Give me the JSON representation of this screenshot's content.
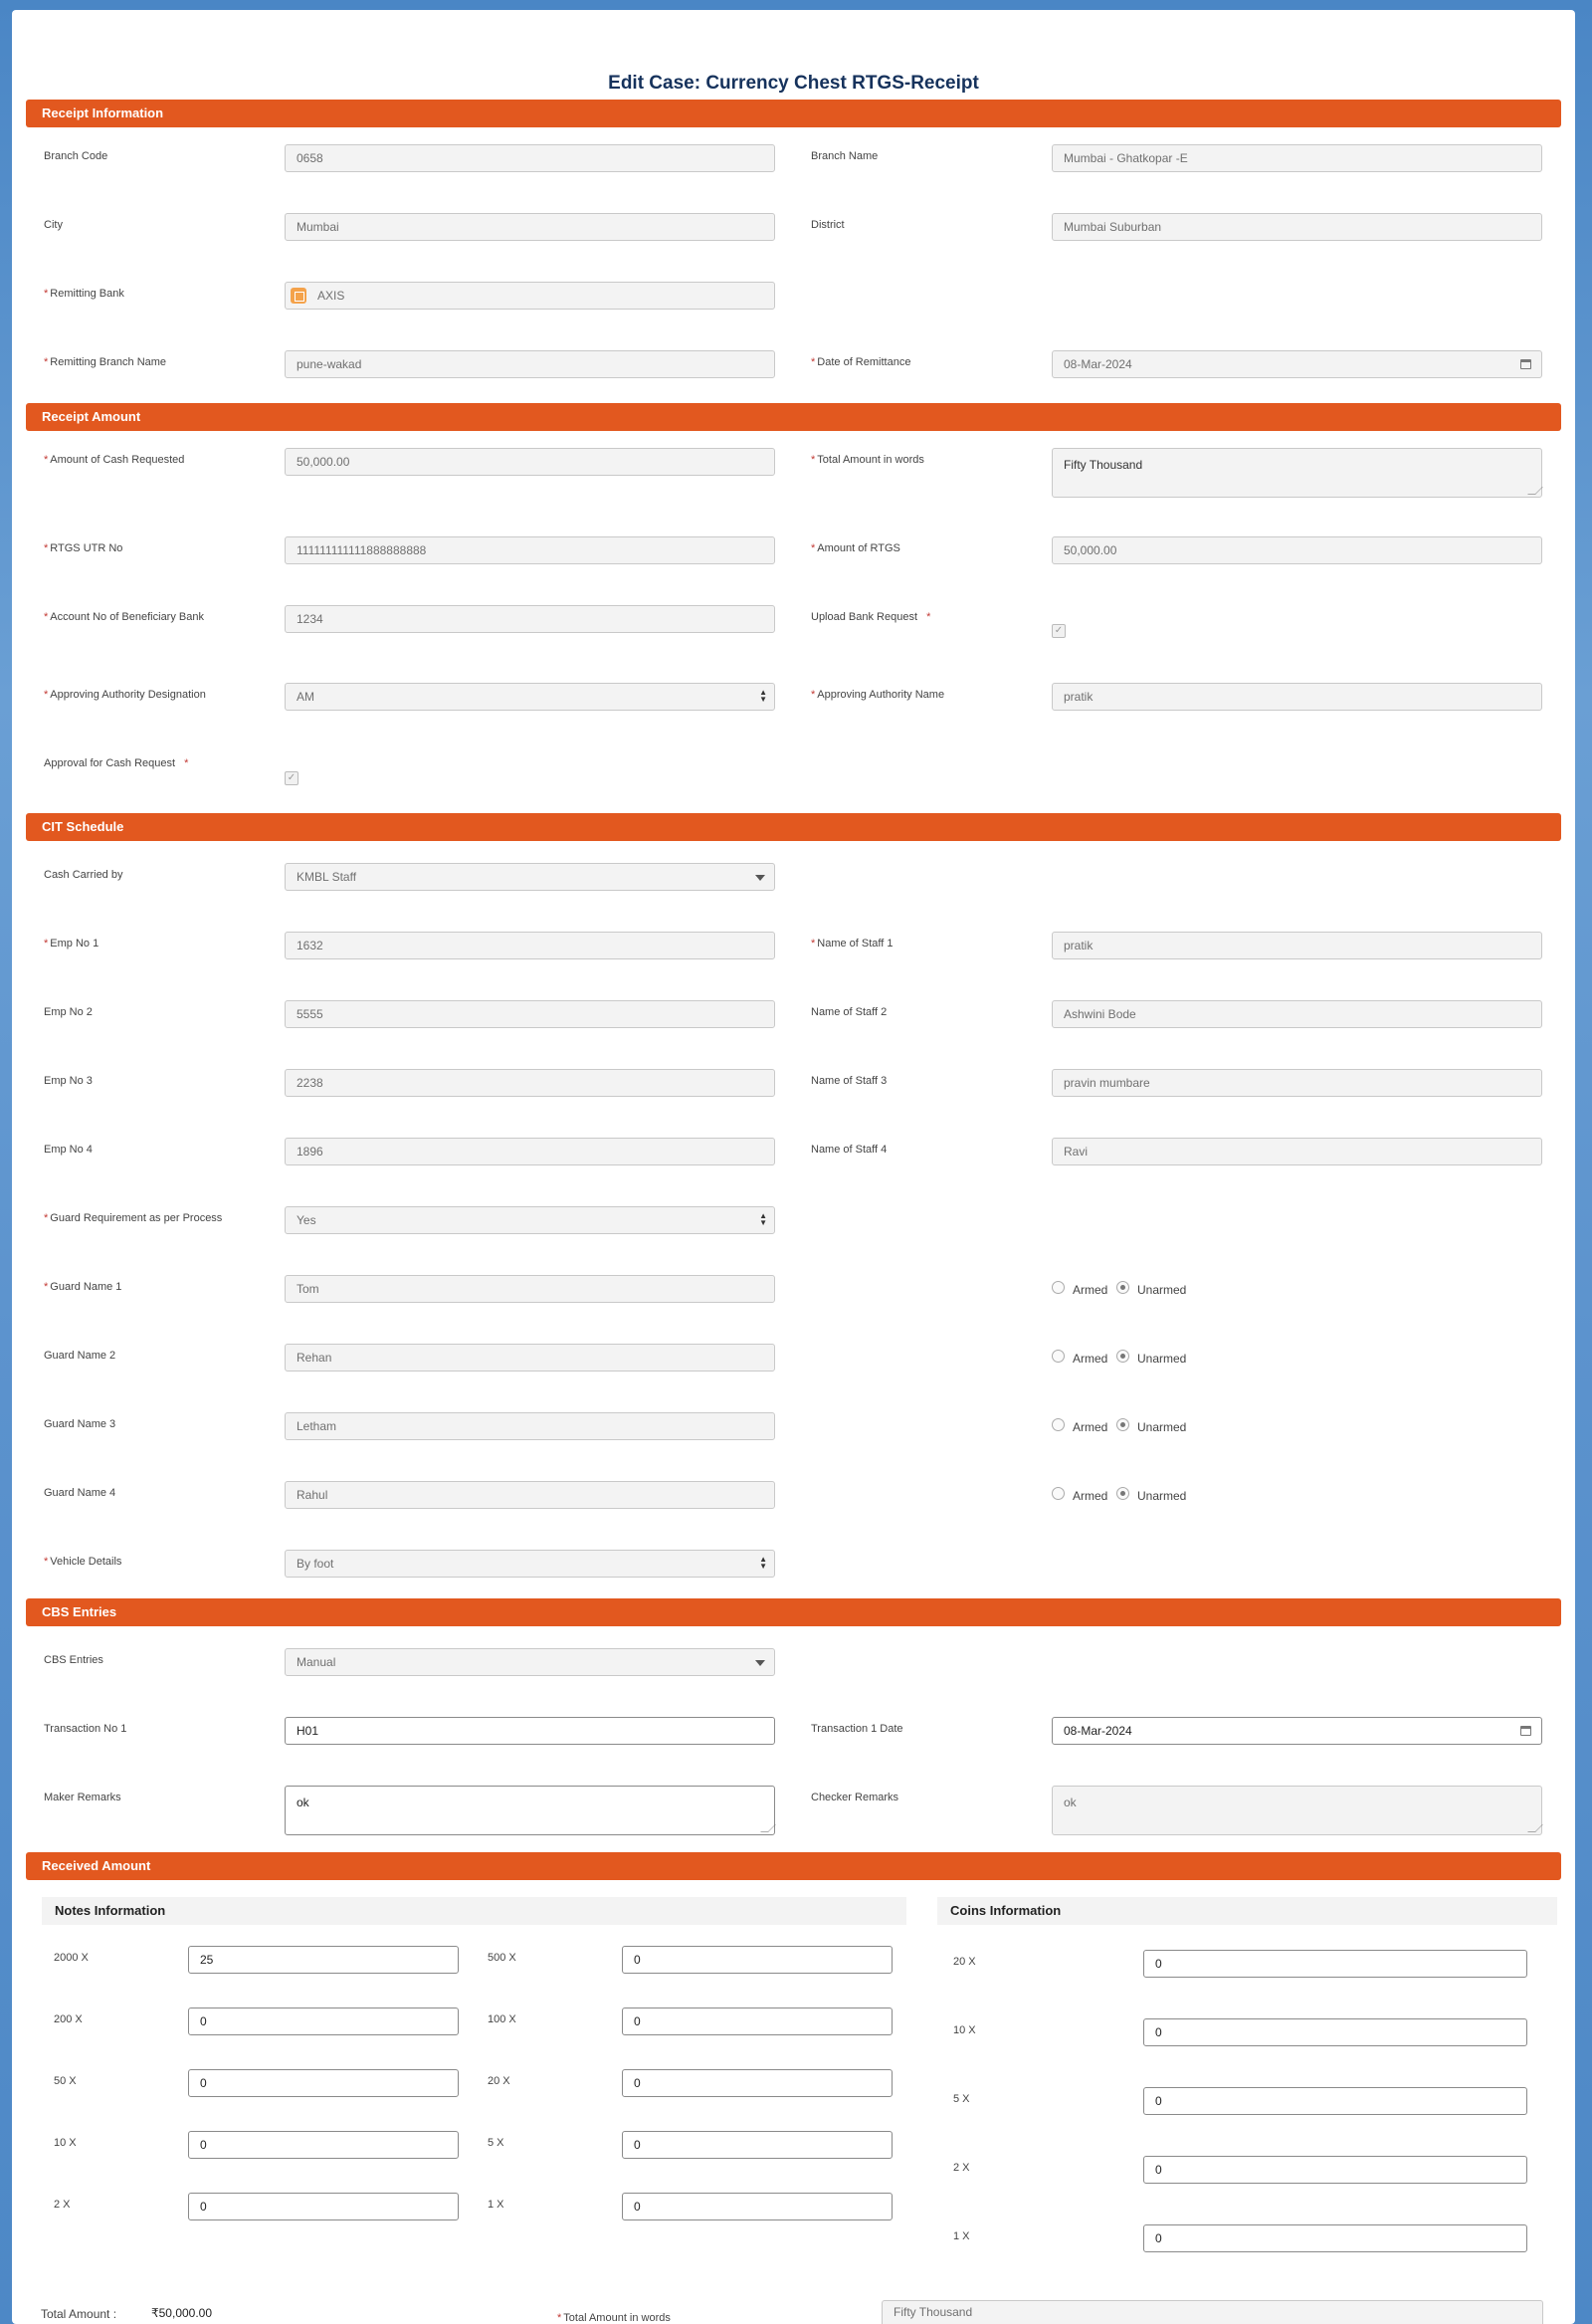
{
  "title": "Edit Case: Currency Chest RTGS-Receipt",
  "sections": {
    "receipt_info": "Receipt Information",
    "receipt_amount": "Receipt Amount",
    "cit_schedule": "CIT Schedule",
    "cbs_entries": "CBS Entries",
    "received_amount": "Received Amount"
  },
  "receipt_info": {
    "branch_code_label": "Branch Code",
    "branch_code": "0658",
    "branch_name_label": "Branch Name",
    "branch_name": "Mumbai - Ghatkopar -E",
    "city_label": "City",
    "city": "Mumbai",
    "district_label": "District",
    "district": "Mumbai Suburban",
    "remitting_bank_label": "Remitting Bank",
    "remitting_bank": "AXIS",
    "remitting_branch_label": "Remitting Branch Name",
    "remitting_branch": "pune-wakad",
    "date_label": "Date of Remittance",
    "date": "08-Mar-2024"
  },
  "receipt_amount": {
    "cash_requested_label": "Amount of Cash Requested",
    "cash_requested": "50,000.00",
    "words_label": "Total Amount in words",
    "words": "Fifty  Thousand",
    "utr_label": "RTGS UTR No",
    "utr": "111111111111888888888",
    "rtgs_amount_label": "Amount of RTGS",
    "rtgs_amount": "50,000.00",
    "account_label": "Account No of Beneficiary Bank",
    "account": "1234",
    "upload_label": "Upload Bank Request",
    "designation_label": "Approving Authority Designation",
    "designation": "AM",
    "authority_name_label": "Approving Authority Name",
    "authority_name": "pratik",
    "approval_label": "Approval for Cash Request"
  },
  "cit": {
    "carried_label": "Cash Carried by",
    "carried": "KMBL Staff",
    "emp1_label": "Emp No 1",
    "emp1": "1632",
    "staff1_label": "Name of Staff 1",
    "staff1": "pratik",
    "emp2_label": "Emp No 2",
    "emp2": "5555",
    "staff2_label": "Name of Staff 2",
    "staff2": "Ashwini Bode",
    "emp3_label": "Emp No 3",
    "emp3": "2238",
    "staff3_label": "Name of Staff 3",
    "staff3": "pravin mumbare",
    "emp4_label": "Emp No 4",
    "emp4": "1896",
    "staff4_label": "Name of Staff 4",
    "staff4": "Ravi",
    "guard_req_label": "Guard Requirement as per Process",
    "guard_req": "Yes",
    "guard1_label": "Guard Name 1",
    "guard1": "Tom",
    "guard2_label": "Guard Name 2",
    "guard2": "Rehan",
    "guard3_label": "Guard Name 3",
    "guard3": "Letham",
    "guard4_label": "Guard Name 4",
    "guard4": "Rahul",
    "armed": "Armed",
    "unarmed": "Unarmed",
    "vehicle_label": "Vehicle Details",
    "vehicle": "By foot"
  },
  "cbs": {
    "entries_label": "CBS Entries",
    "entries": "Manual",
    "txn_label": "Transaction No 1",
    "txn": "H01",
    "txn_date_label": "Transaction 1 Date",
    "txn_date": "08-Mar-2024",
    "maker_label": "Maker Remarks",
    "maker": "ok",
    "checker_label": "Checker Remarks",
    "checker": "ok"
  },
  "received": {
    "notes_title": "Notes Information",
    "coins_title": "Coins Information",
    "notes": [
      {
        "label": "2000 X",
        "value": "25"
      },
      {
        "label": "500 X",
        "value": "0"
      },
      {
        "label": "200 X",
        "value": "0"
      },
      {
        "label": "100 X",
        "value": "0"
      },
      {
        "label": "50 X",
        "value": "0"
      },
      {
        "label": "20 X",
        "value": "0"
      },
      {
        "label": "10 X",
        "value": "0"
      },
      {
        "label": "5 X",
        "value": "0"
      },
      {
        "label": "2 X",
        "value": "0"
      },
      {
        "label": "1 X",
        "value": "0"
      }
    ],
    "coins": [
      {
        "label": "20 X",
        "value": "0"
      },
      {
        "label": "10 X",
        "value": "0"
      },
      {
        "label": "5 X",
        "value": "0"
      },
      {
        "label": "2 X",
        "value": "0"
      },
      {
        "label": "1 X",
        "value": "0"
      }
    ],
    "total_label": "Total Amount :",
    "total": "₹50,000.00",
    "words_label": "Total Amount in words",
    "words": "Fifty  Thousand"
  }
}
